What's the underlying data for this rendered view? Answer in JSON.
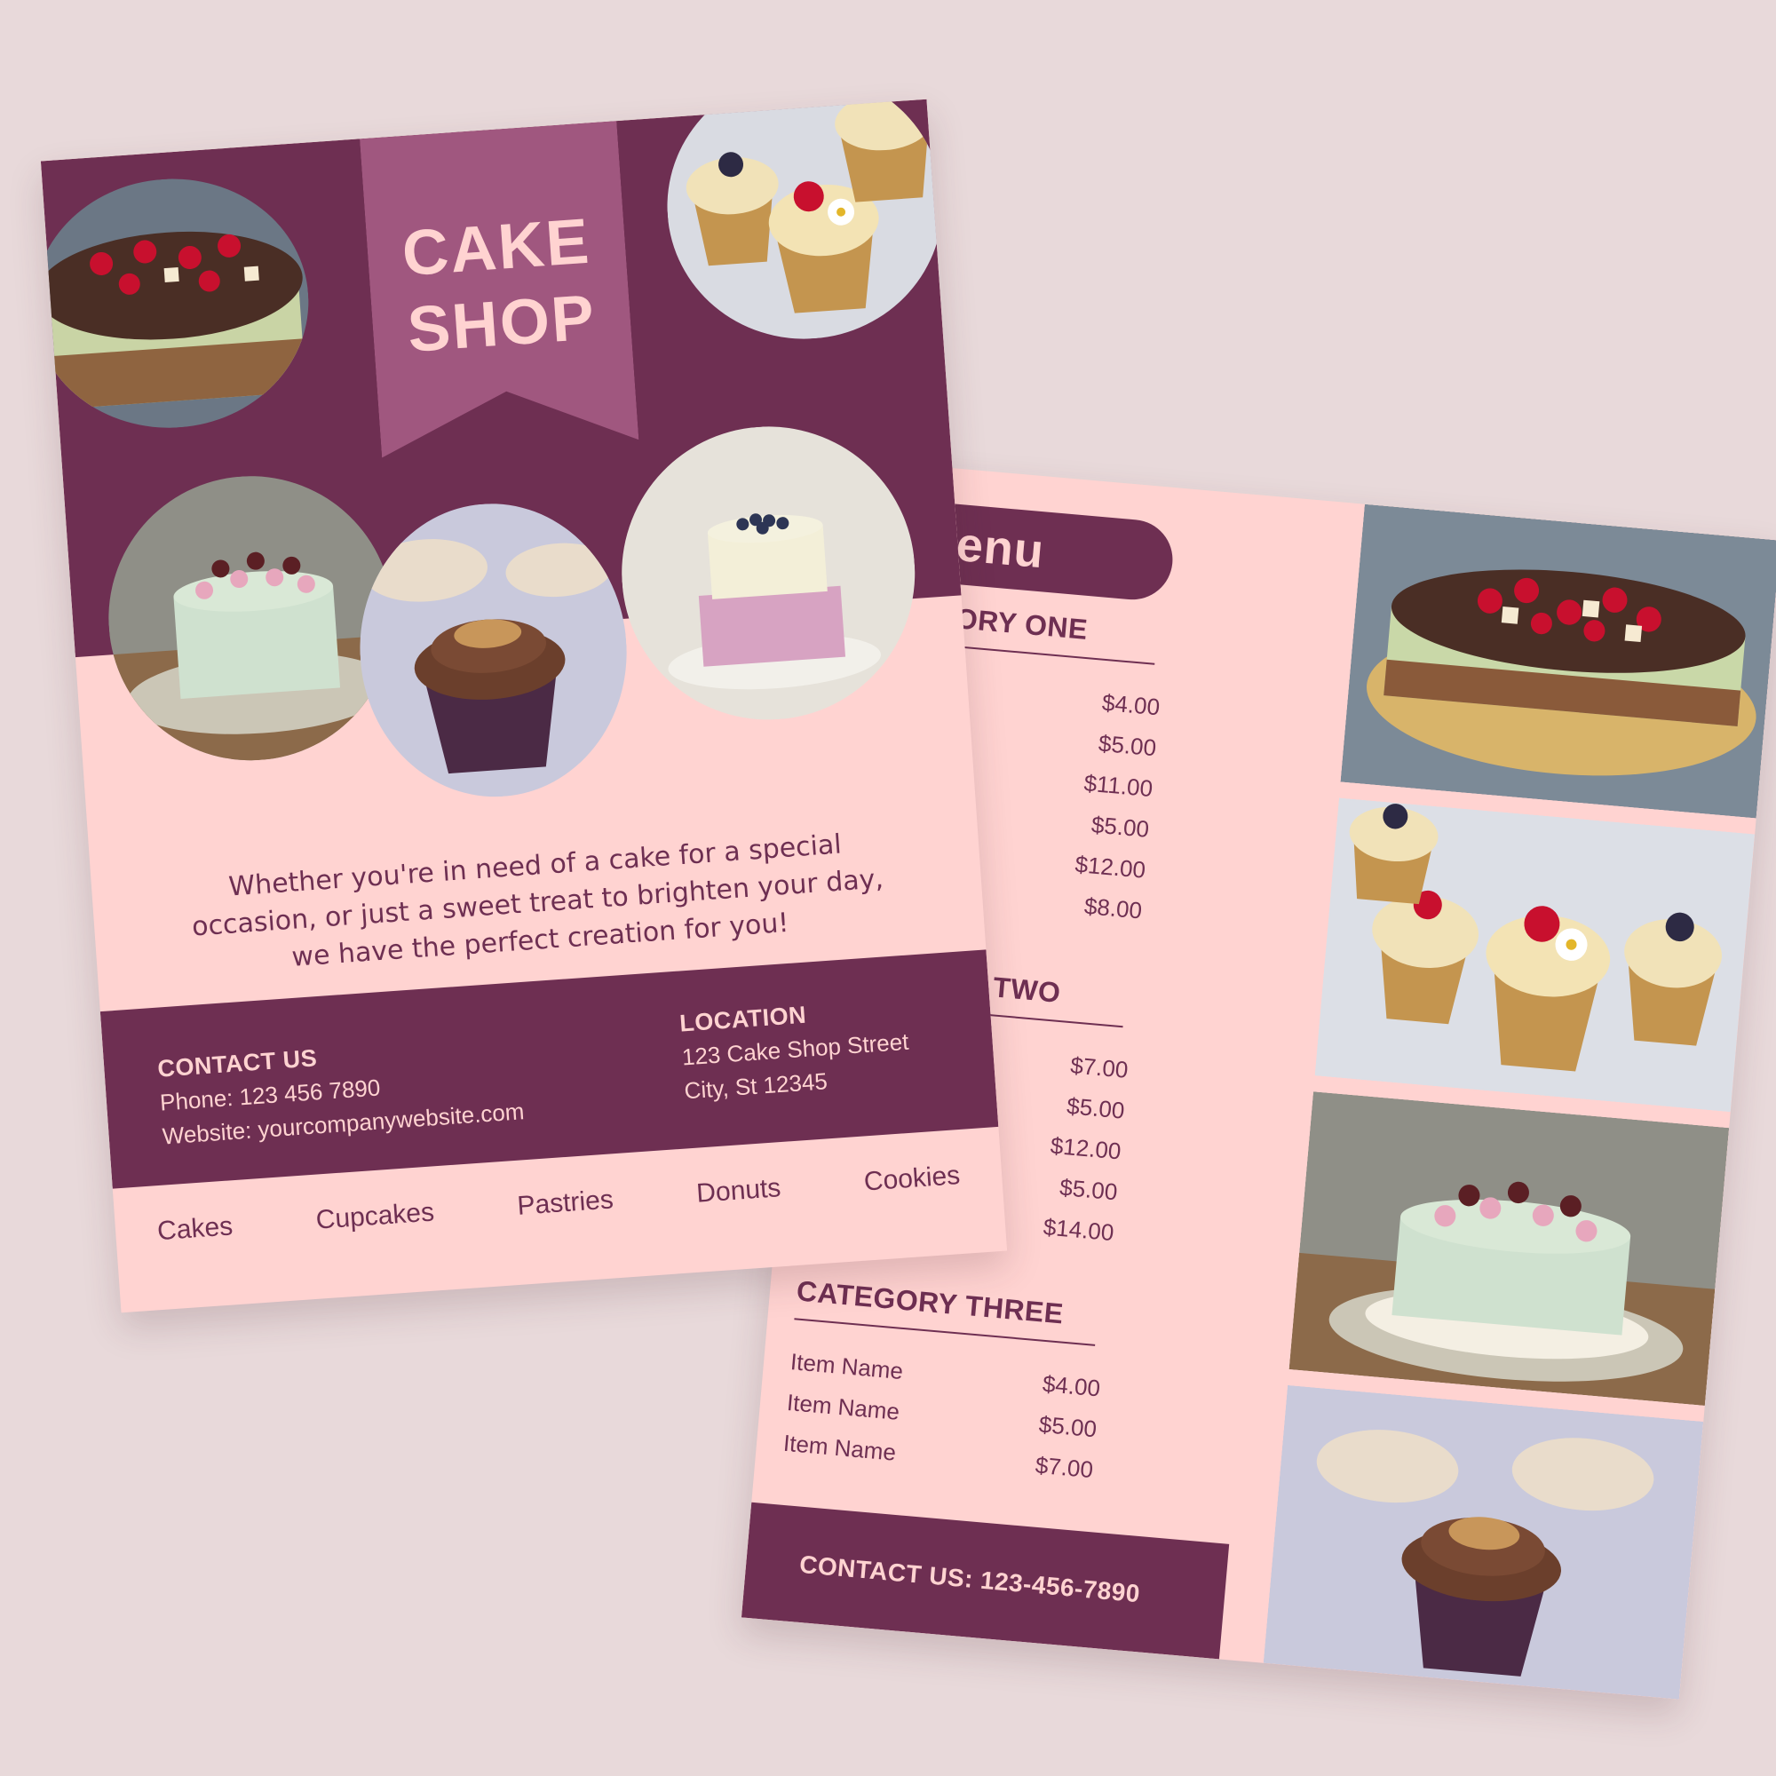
{
  "flyer": {
    "title_line1": "CAKE",
    "title_line2": "SHOP",
    "tagline": "Whether you're in need of a cake for a special occasion, or just a sweet treat to brighten your day, we have the perfect creation for you!",
    "contact": {
      "heading": "CONTACT US",
      "phone": "Phone: 123 456 7890",
      "website": "Website: yourcompanywebsite.com"
    },
    "location": {
      "heading": "LOCATION",
      "street": "123 Cake Shop Street",
      "city": "City, St 12345"
    },
    "categories": [
      "Cakes",
      "Cupcakes",
      "Pastries",
      "Donuts",
      "Cookies"
    ]
  },
  "menu": {
    "title": "Menu",
    "category_one": {
      "title": "CATEGORY ONE",
      "prices": [
        "$4.00",
        "$5.00",
        "$11.00",
        "$5.00",
        "$12.00",
        "$8.00"
      ]
    },
    "category_two": {
      "title": "CATEGORY TWO",
      "prices": [
        "$7.00",
        "$5.00",
        "$12.00",
        "$5.00",
        "$14.00"
      ]
    },
    "category_three": {
      "title": "CATEGORY THREE",
      "items": [
        "Item Name",
        "Item Name",
        "Item Name"
      ],
      "prices": [
        "$4.00",
        "$5.00",
        "$7.00"
      ]
    },
    "footer": "CONTACT US: 123-456-7890"
  },
  "colors": {
    "plum": "#6e2f52",
    "pink": "#ffd3d1",
    "mauve": "#a0577f",
    "background": "#e8d9da"
  }
}
